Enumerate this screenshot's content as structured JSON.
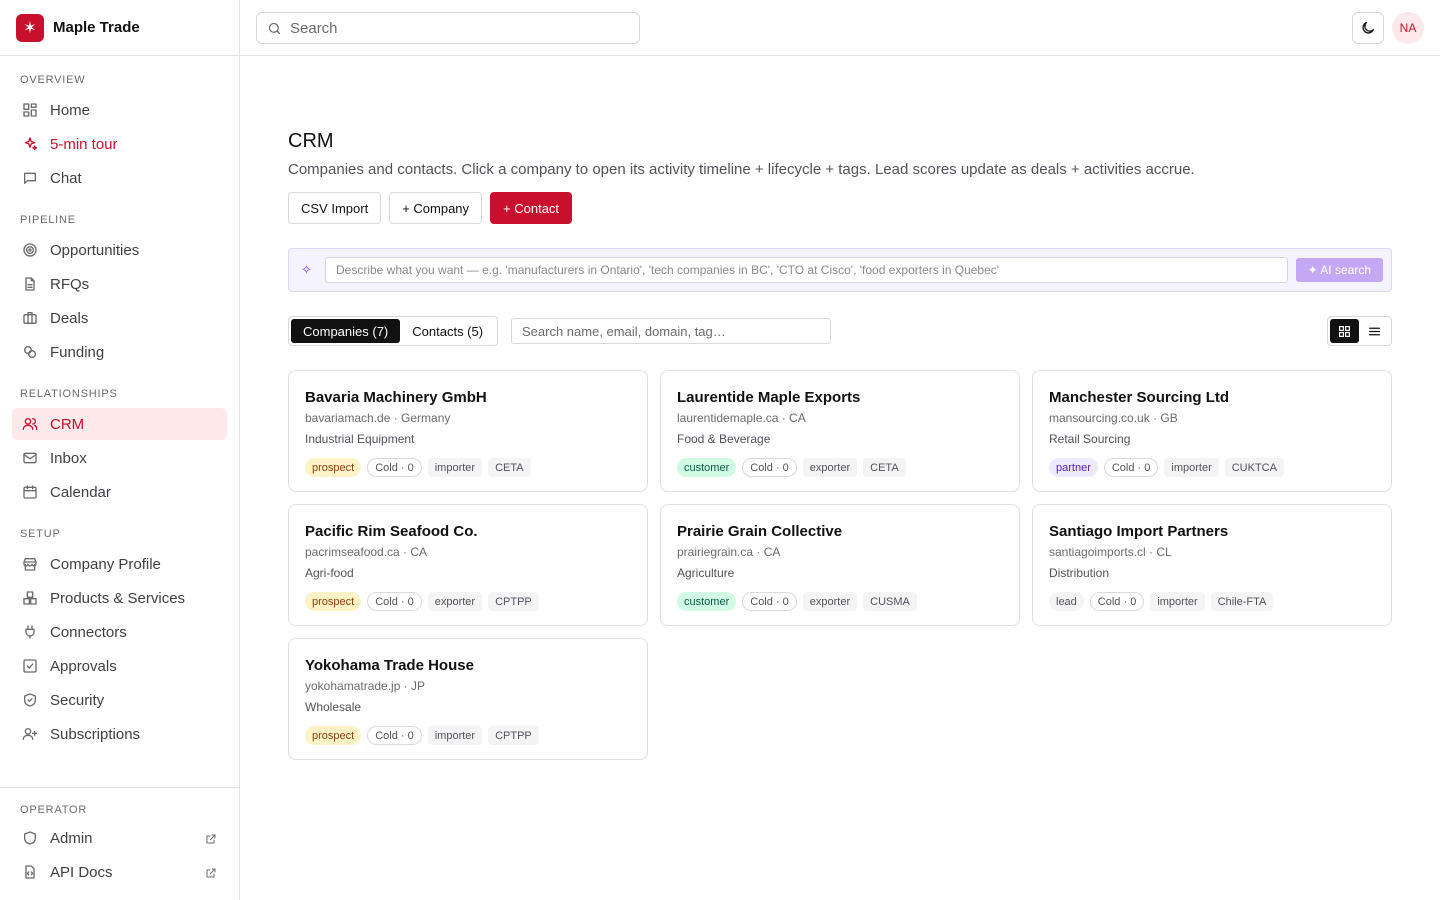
{
  "app": {
    "name": "Maple Trade",
    "logo_glyph": "✶",
    "brand_color": "#c8102e"
  },
  "sidebar": {
    "sections": [
      {
        "heading": "OVERVIEW",
        "items": [
          {
            "label": "Home",
            "icon": "home-icon"
          },
          {
            "label": "5-min tour",
            "icon": "sparkles-icon"
          },
          {
            "label": "Chat",
            "icon": "chat-icon"
          }
        ]
      },
      {
        "heading": "PIPELINE",
        "items": [
          {
            "label": "Opportunities",
            "icon": "target-icon"
          },
          {
            "label": "RFQs",
            "icon": "document-icon"
          },
          {
            "label": "Deals",
            "icon": "briefcase-icon"
          },
          {
            "label": "Funding",
            "icon": "coins-icon"
          }
        ]
      },
      {
        "heading": "RELATIONSHIPS",
        "items": [
          {
            "label": "CRM",
            "icon": "users-icon"
          },
          {
            "label": "Inbox",
            "icon": "mail-icon"
          },
          {
            "label": "Calendar",
            "icon": "calendar-icon"
          }
        ]
      },
      {
        "heading": "SETUP",
        "items": [
          {
            "label": "Company Profile",
            "icon": "store-icon"
          },
          {
            "label": "Products & Services",
            "icon": "boxes-icon"
          },
          {
            "label": "Connectors",
            "icon": "plug-icon"
          },
          {
            "label": "Approvals",
            "icon": "checkbox-icon"
          },
          {
            "label": "Security",
            "icon": "shield-check-icon"
          },
          {
            "label": "Subscriptions",
            "icon": "user-plus-icon"
          }
        ]
      }
    ],
    "operator": {
      "heading": "OPERATOR",
      "items": [
        {
          "label": "Admin",
          "icon": "shield-icon"
        },
        {
          "label": "API Docs",
          "icon": "code-file-icon"
        }
      ]
    }
  },
  "topbar": {
    "search_placeholder": "Search",
    "avatar_initials": "NA"
  },
  "page": {
    "title": "CRM",
    "subtitle": "Companies and contacts. Click a company to open its activity timeline + lifecycle + tags. Lead scores update as deals + activities accrue.",
    "actions": {
      "csv_import": "CSV Import",
      "add_company": "+ Company",
      "add_contact": "+ Contact"
    },
    "ai_search": {
      "spark": "✧",
      "placeholder": "Describe what you want — e.g. 'manufacturers in Ontario', 'tech companies in BC', 'CTO at Cisco', 'food exporters in Quebec'",
      "button": "✦ AI search"
    },
    "tabs": {
      "companies": "Companies (7)",
      "contacts": "Contacts (5)"
    },
    "filter_placeholder": "Search name, email, domain, tag…",
    "stage_colors": {
      "prospect": {
        "bg": "#fef3c7",
        "fg": "#92400e"
      },
      "customer": {
        "bg": "#d1fae5",
        "fg": "#065f46"
      },
      "partner": {
        "bg": "#ede9fe",
        "fg": "#5b21b6"
      },
      "lead": {
        "bg": "#f4f4f5",
        "fg": "#52525b"
      }
    },
    "companies": [
      {
        "name": "Bavaria Machinery GmbH",
        "meta": "bavariamach.de · Germany",
        "industry": "Industrial Equipment",
        "stage": "prospect",
        "score": "Cold · 0",
        "role": "importer",
        "agreement": "CETA"
      },
      {
        "name": "Laurentide Maple Exports",
        "meta": "laurentidemaple.ca · CA",
        "industry": "Food & Beverage",
        "stage": "customer",
        "score": "Cold · 0",
        "role": "exporter",
        "agreement": "CETA"
      },
      {
        "name": "Manchester Sourcing Ltd",
        "meta": "mansourcing.co.uk · GB",
        "industry": "Retail Sourcing",
        "stage": "partner",
        "score": "Cold · 0",
        "role": "importer",
        "agreement": "CUKTCA"
      },
      {
        "name": "Pacific Rim Seafood Co.",
        "meta": "pacrimseafood.ca · CA",
        "industry": "Agri-food",
        "stage": "prospect",
        "score": "Cold · 0",
        "role": "exporter",
        "agreement": "CPTPP"
      },
      {
        "name": "Prairie Grain Collective",
        "meta": "prairiegrain.ca · CA",
        "industry": "Agriculture",
        "stage": "customer",
        "score": "Cold · 0",
        "role": "exporter",
        "agreement": "CUSMA"
      },
      {
        "name": "Santiago Import Partners",
        "meta": "santiagoimports.cl · CL",
        "industry": "Distribution",
        "stage": "lead",
        "score": "Cold · 0",
        "role": "importer",
        "agreement": "Chile-FTA"
      },
      {
        "name": "Yokohama Trade House",
        "meta": "yokohamatrade.jp · JP",
        "industry": "Wholesale",
        "stage": "prospect",
        "score": "Cold · 0",
        "role": "importer",
        "agreement": "CPTPP"
      }
    ]
  }
}
